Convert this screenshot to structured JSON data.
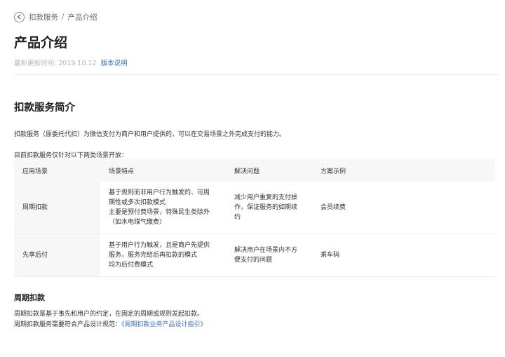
{
  "breadcrumb": {
    "items": [
      "扣款服务",
      "产品介绍"
    ],
    "separator": "/"
  },
  "title": "产品介绍",
  "updated": {
    "label": "最新更新时间:",
    "date": "2019.10.12",
    "link": "版本说明"
  },
  "section": {
    "heading": "扣款服务简介",
    "intro": "扣款服务（原委托代扣）为微信支付为商户和用户提供的，可以在交易场景之外完成支付的能力。",
    "table_intro": "目前扣款服务仅针对以下两类场景开放："
  },
  "table": {
    "headers": [
      "应用场景",
      "场景特点",
      "解决问题",
      "方案示例"
    ],
    "rows": [
      {
        "scene": "周期扣款",
        "features": [
          "基于规则而非用户行为触发的、可周",
          "期性或多次扣款模式",
          "主要是预付费场景，特殊民生类除外",
          "（如水电煤气缴费）"
        ],
        "problem": [
          "减少用户重复的支付操",
          "作，保证服务的如期续",
          "约"
        ],
        "example": "会员续费"
      },
      {
        "scene": "先享后付",
        "features": [
          "基于用户行为触发，且是商户先提供",
          "服务，服务完结后再扣款的模式",
          "均为后付费模式"
        ],
        "problem": [
          "解决用户在场景内不方",
          "便支付的问题"
        ],
        "example": "乘车码"
      }
    ]
  },
  "periodic": {
    "heading": "周期扣款",
    "line1": "周期扣款是基于事先和用户的约定，在固定的周期或规则发起扣款。",
    "line2_prefix": "周期扣款服务需要符合产品设计规范：",
    "line2_link": "《周期扣款业务产品设计指引》"
  }
}
